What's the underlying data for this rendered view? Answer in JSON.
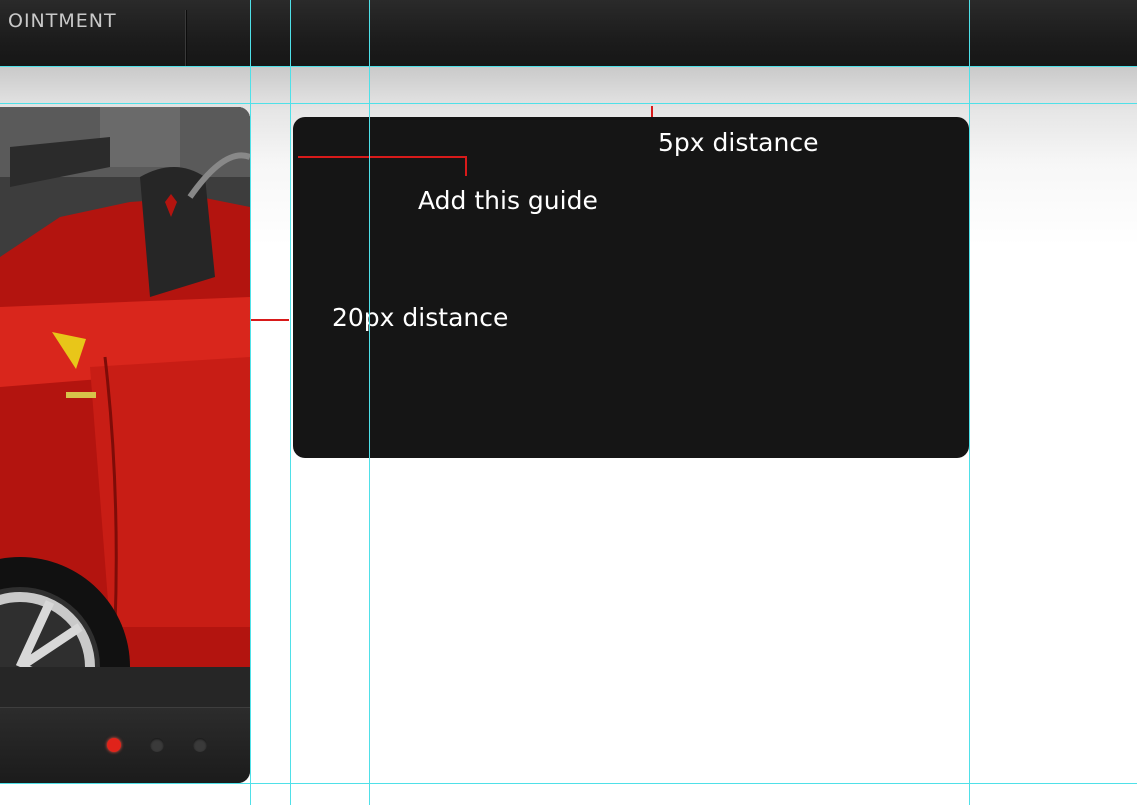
{
  "nav": {
    "item_label": "OINTMENT"
  },
  "annotations": {
    "top_distance": "5px distance",
    "add_guide": "Add this guide",
    "side_distance": "20px distance"
  },
  "slider": {
    "dots": [
      "active",
      "inactive",
      "inactive"
    ]
  },
  "colors": {
    "nav_bg": "#1c1c1c",
    "box_bg": "#151515",
    "guide": "#4fe0e8",
    "marker": "#d81a1a",
    "car_red": "#c41a14",
    "dot_active": "#e0231a"
  }
}
